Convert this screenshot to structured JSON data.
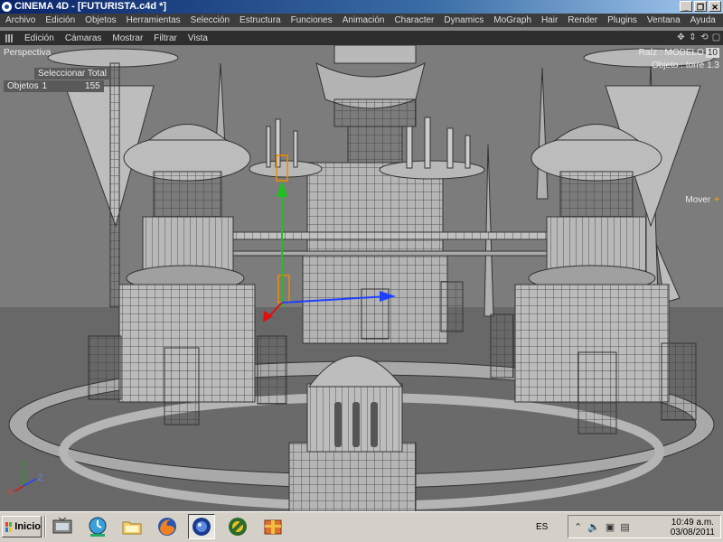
{
  "window": {
    "title": "CINEMA 4D - [FUTURISTA.c4d *]",
    "minimize_glyph": "_",
    "restore_glyph": "❐",
    "close_glyph": "✕"
  },
  "main_menu": [
    "Archivo",
    "Edición",
    "Objetos",
    "Herramientas",
    "Selección",
    "Estructura",
    "Funciones",
    "Animación",
    "Character",
    "Dynamics",
    "MoGraph",
    "Hair",
    "Render",
    "Plugins",
    "Ventana",
    "Ayuda"
  ],
  "viewport_menu": [
    "Edición",
    "Cámaras",
    "Mostrar",
    "Filtrar",
    "Vista"
  ],
  "viewport_nav_icons": [
    "move-view-icon",
    "dolly-view-icon",
    "rotate-view-icon",
    "maximize-view-icon"
  ],
  "viewport_nav_glyphs": [
    "✥",
    "⇕",
    "⟲",
    "▢"
  ],
  "hud": {
    "view_name": "Perspectiva",
    "select_all": "Seleccionar Total",
    "objects_label": "Objetos",
    "objects_count": "1",
    "polygons_count": "155",
    "root_label": "Raíz : MODELO",
    "root_tag": "10",
    "object_label": "Objeto : torre 1.3",
    "tool_label": "Mover",
    "tool_glyph": "+",
    "axis_x": "X",
    "axis_y": "Y",
    "axis_z": "Z"
  },
  "colors": {
    "model_fill": "#b9b9b9",
    "model_dark": "#8e8e8e",
    "wire": "#3a3a3a",
    "ground": "#676767",
    "axis_x": "#e01010",
    "axis_y": "#20c020",
    "axis_z": "#2040ff",
    "selection": "#f08a00"
  },
  "taskbar": {
    "start_label": "Inicio",
    "apps": [
      "tv-icon",
      "timer-icon",
      "folder-icon",
      "firefox-icon",
      "cinema4d-icon",
      "tool-icon",
      "archive-icon"
    ],
    "language": "ES",
    "tray_icons": [
      "chevron-up-icon",
      "volume-icon",
      "printer-icon",
      "network-icon"
    ],
    "tray_glyphs": [
      "⌃",
      "🔈",
      "▣",
      "▤"
    ],
    "time": "10:49 a.m.",
    "date": "03/08/2011"
  }
}
